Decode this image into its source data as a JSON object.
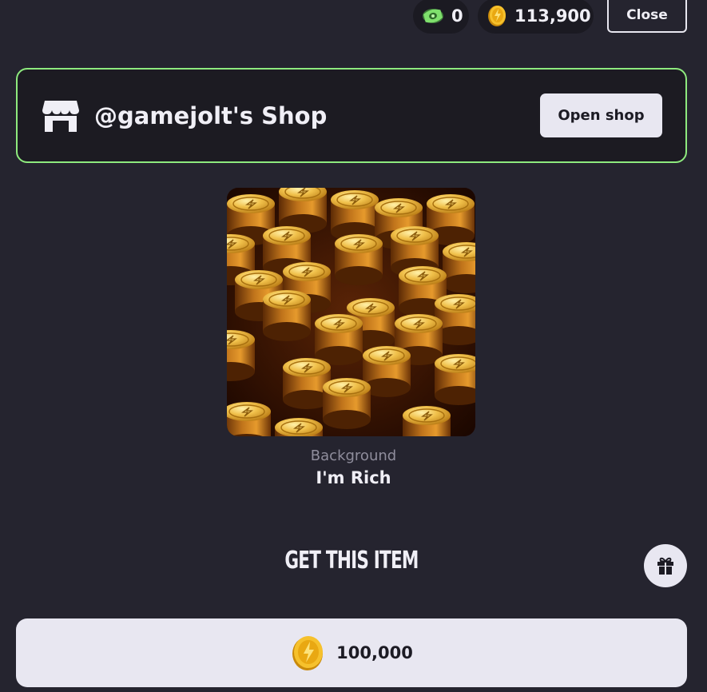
{
  "currency": {
    "cash_value": "0",
    "coins_value": "113,900",
    "cash_icon": "cash-icon",
    "coin_icon": "coin-icon"
  },
  "header": {
    "close_label": "Close"
  },
  "shop": {
    "title": "@gamejolt's Shop",
    "open_label": "Open shop",
    "icon": "shop-icon",
    "border_color": "#8eea7e"
  },
  "item": {
    "type": "Background",
    "name": "I'm Rich",
    "image": "gold-coins-pattern"
  },
  "purchase": {
    "heading": "GET THIS ITEM",
    "price": "100,000",
    "gift_icon": "gift-icon"
  },
  "colors": {
    "background": "#25242f",
    "card": "#1c1b22",
    "button": "#e8e7f1",
    "accent": "#8eea7e"
  }
}
